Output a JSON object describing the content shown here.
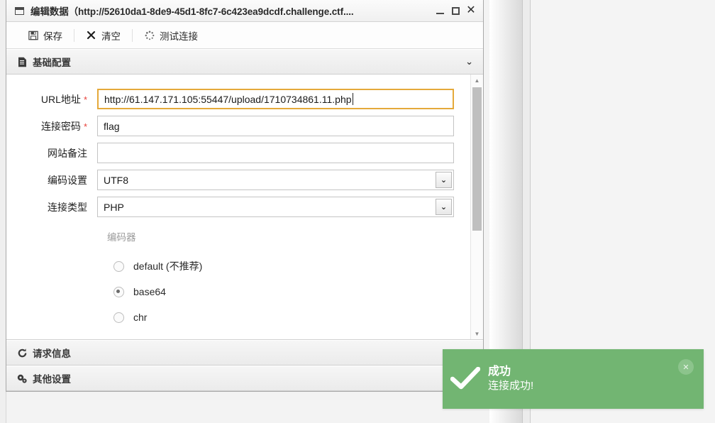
{
  "window": {
    "title": "编辑数据（http://52610da1-8de9-45d1-8fc7-6c423ea9dcdf.challenge.ctf....",
    "icon": "window-icon",
    "controls": {
      "minimize": "_",
      "maximize": "□",
      "close": "✕"
    }
  },
  "toolbar": {
    "save_label": "保存",
    "save_icon": "floppy-disk-icon",
    "clear_label": "清空",
    "clear_icon": "cross-icon",
    "test_label": "测试连接",
    "test_icon": "spinner-icon"
  },
  "sections": {
    "basic": {
      "title": "基础配置",
      "icon": "document-icon",
      "chevron": "⌄"
    },
    "request": {
      "title": "请求信息",
      "icon": "refresh-icon"
    },
    "other": {
      "title": "其他设置",
      "icon": "gears-icon"
    }
  },
  "form": {
    "url": {
      "label": "URL地址",
      "required": "*",
      "value": "http://61.147.171.105:55447/upload/1710734861.11.php",
      "placeholder": ""
    },
    "password": {
      "label": "连接密码",
      "required": "*",
      "value": "flag",
      "placeholder": ""
    },
    "note": {
      "label": "网站备注",
      "required": "",
      "value": "",
      "placeholder": ""
    },
    "encoding": {
      "label": "编码设置",
      "value": "UTF8",
      "arrow": "⌄"
    },
    "conn_type": {
      "label": "连接类型",
      "value": "PHP",
      "arrow": "⌄"
    },
    "encoder": {
      "title": "编码器",
      "options": [
        {
          "label": "default (不推荐)",
          "checked": false
        },
        {
          "label": "base64",
          "checked": true
        },
        {
          "label": "chr",
          "checked": false
        }
      ]
    }
  },
  "scrollbar": {
    "up_arrow": "▲",
    "down_arrow": "▼"
  },
  "toast": {
    "title": "成功",
    "message": "连接成功!",
    "check_icon": "check-icon",
    "close_label": "✕",
    "color": "#72b572"
  }
}
